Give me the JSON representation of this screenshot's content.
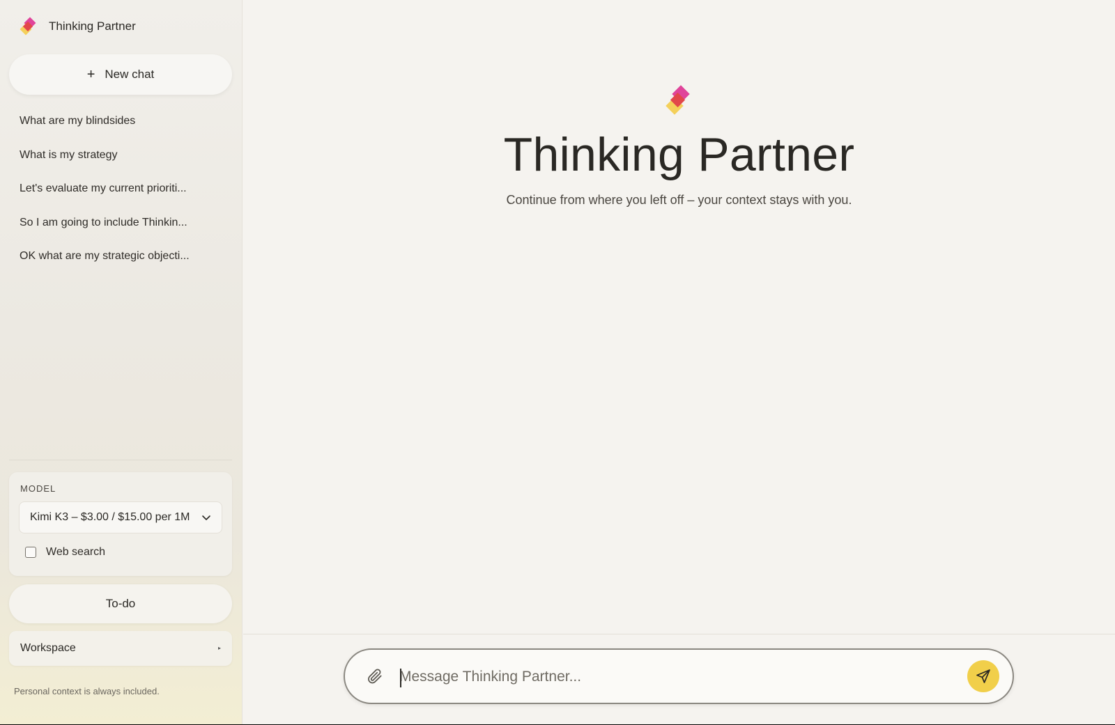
{
  "app": {
    "name": "Thinking Partner",
    "colors": {
      "accent_yellow": "#f1cf4a",
      "logo_pink": "#e0449a",
      "logo_red": "#e2474a",
      "logo_yellow": "#f4d05a"
    }
  },
  "sidebar": {
    "new_chat_label": "New chat",
    "history": [
      "What are my blindsides",
      "What is my strategy",
      "Let's evaluate my current prioriti...",
      "So I am going to include Thinkin...",
      "OK what are my strategic objecti..."
    ],
    "model_label": "MODEL",
    "model_selected": "Kimi K3 – $3.00 / $15.00 per 1M",
    "web_search_label": "Web search",
    "web_search_checked": false,
    "todo_label": "To-do",
    "workspace_label": "Workspace",
    "footnote": "Personal context is always included."
  },
  "main": {
    "title": "Thinking Partner",
    "subtitle": "Continue from where you left off – your context stays with you.",
    "composer_placeholder": "Message Thinking Partner..."
  },
  "icons": {
    "logo": "logo-icon",
    "plus": "plus-icon",
    "chevron": "chevron-down-icon",
    "attach": "paperclip-icon",
    "send": "send-icon"
  }
}
